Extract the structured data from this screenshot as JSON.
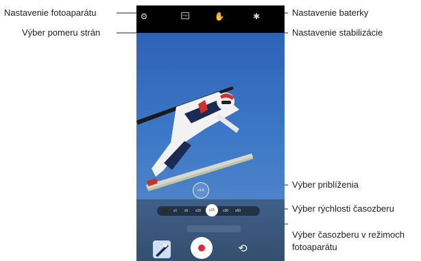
{
  "callouts": {
    "camera_settings": "Nastavenie fotoaparátu",
    "aspect_ratio": "Výber pomeru strán",
    "flash_settings": "Nastavenie baterky",
    "stabilization_settings": "Nastavenie stabilizácie",
    "zoom_select": "Výber priblíženia",
    "timelapse_speed": "Výber rýchlosti časozberu",
    "photo_mode_line1": "Výber časozberu v režimoch",
    "photo_mode_line2": "fotoaparátu"
  },
  "camera_ui": {
    "zoom_value": "x1.0",
    "speed_options": [
      "x1",
      "x5",
      "x10",
      "x15",
      "x30",
      "x60"
    ],
    "speed_selected": "x15",
    "ratio_label": "FHD"
  },
  "icons": {
    "settings": "gear-icon",
    "ratio": "aspect-ratio-icon",
    "stabilization": "stabilization-hand-icon",
    "flash": "flash-icon",
    "record": "record-icon",
    "switch": "switch-camera-icon",
    "gallery": "gallery-thumbnail"
  }
}
